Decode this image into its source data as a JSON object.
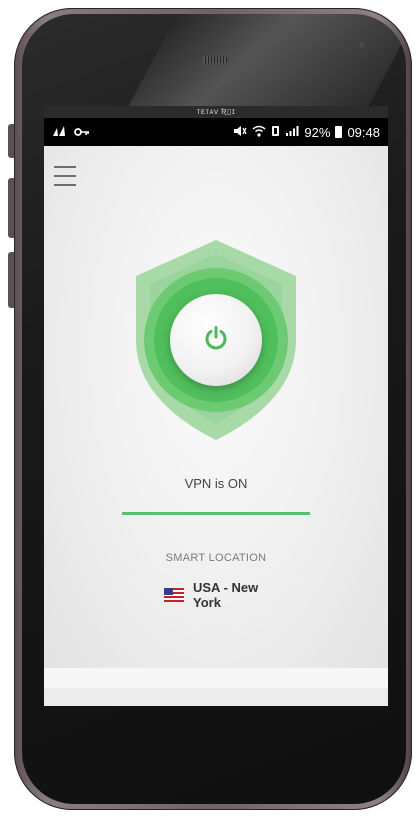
{
  "statusbar": {
    "top_label": "ᴛᴇᴛᴀᴠ Ʀ▯ɪ",
    "left_icons": [
      "signal-alt-icon",
      "key-icon"
    ],
    "right_icons": [
      "mute-icon",
      "wifi-icon",
      "data-icon",
      "cell-signal-icon",
      "battery-icon"
    ],
    "battery": "92%",
    "time": "09:48"
  },
  "app": {
    "menu_icon": "hamburger-menu-icon",
    "power_icon": "power-icon",
    "status_text": "VPN is ON",
    "smart_location_label": "SMART LOCATION",
    "location_name": "USA - New York",
    "location_flag": "us-flag-icon"
  },
  "colors": {
    "accent_green": "#5cc06a",
    "shield_outer": "#9ad49a",
    "shield_inner": "#56c360",
    "power_glyph": "#4cb85a"
  }
}
